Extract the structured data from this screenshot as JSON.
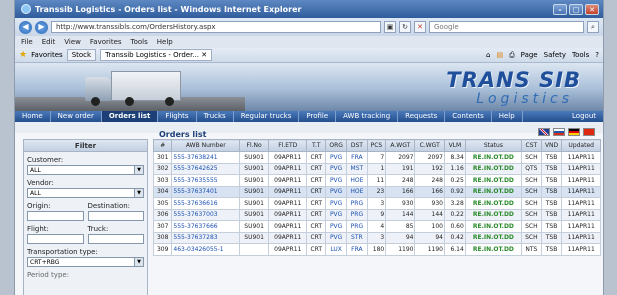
{
  "browser": {
    "title": "Transsib Logistics - Orders list - Windows Internet Explorer",
    "url": "http://www.transsibls.com/OrdersHistory.aspx",
    "search_placeholder": "Google",
    "menu": [
      "File",
      "Edit",
      "View",
      "Favorites",
      "Tools",
      "Help"
    ],
    "favorites_label": "Favorites",
    "tabs": [
      "Stock",
      "Transsib Logistics - Order..."
    ],
    "commands": [
      "Page",
      "Safety",
      "Tools"
    ]
  },
  "brand": {
    "line1": "TRANS SIB",
    "line2": "Logistics"
  },
  "nav": [
    "Home",
    "New order",
    "Orders list",
    "Flights",
    "Trucks",
    "Regular trucks",
    "Profile",
    "AWB tracking",
    "Requests",
    "Contents",
    "Help",
    "Logout"
  ],
  "nav_active": "Orders list",
  "page_title": "Orders list",
  "filter": {
    "title": "Filter",
    "customer_label": "Customer:",
    "customer_value": "ALL",
    "vendor_label": "Vendor:",
    "vendor_value": "ALL",
    "origin_label": "Origin:",
    "destination_label": "Destination:",
    "flight_label": "Flight:",
    "truck_label": "Truck:",
    "transport_label": "Transportation type:",
    "transport_value": "CRT+RBG",
    "period_label": "Period type:"
  },
  "table": {
    "columns": [
      "#",
      "AWB Number",
      "Fl.No",
      "Fl.ETD",
      "T.T",
      "ORG",
      "DST",
      "PCS",
      "A.WGT",
      "C.WGT",
      "VLM",
      "Status",
      "CST",
      "VND",
      "Updated"
    ],
    "rows": [
      [
        "301",
        "555-37638241",
        "SU901",
        "09APR11",
        "CRT",
        "PVG",
        "FRA",
        "7",
        "2097",
        "2097",
        "8.34",
        "RE.IN.OT.DD",
        "SCH",
        "TSB",
        "11APR11"
      ],
      [
        "302",
        "555-37642625",
        "SU901",
        "09APR11",
        "CRT",
        "PVG",
        "MST",
        "1",
        "191",
        "192",
        "1.16",
        "RE.IN.OT.DD",
        "QTS",
        "TSB",
        "11APR11"
      ],
      [
        "303",
        "555-37635555",
        "SU901",
        "09APR11",
        "CRT",
        "PVG",
        "HOE",
        "11",
        "248",
        "248",
        "0.25",
        "RE.IN.OT.DD",
        "SCH",
        "TSB",
        "11APR11"
      ],
      [
        "304",
        "555-37637401",
        "SU901",
        "09APR11",
        "CRT",
        "PVG",
        "HOE",
        "23",
        "166",
        "166",
        "0.92",
        "RE.IN.OT.DD",
        "SCH",
        "TSB",
        "11APR11"
      ],
      [
        "305",
        "555-37636616",
        "SU901",
        "09APR11",
        "CRT",
        "PVG",
        "PRG",
        "3",
        "930",
        "930",
        "3.28",
        "RE.IN.OT.DD",
        "SCH",
        "TSB",
        "11APR11"
      ],
      [
        "306",
        "555-37637003",
        "SU901",
        "09APR11",
        "CRT",
        "PVG",
        "PRG",
        "9",
        "144",
        "144",
        "0.22",
        "RE.IN.OT.DD",
        "SCH",
        "TSB",
        "11APR11"
      ],
      [
        "307",
        "555-37637666",
        "SU901",
        "09APR11",
        "CRT",
        "PVG",
        "PRG",
        "4",
        "85",
        "100",
        "0.60",
        "RE.IN.OT.DD",
        "SCH",
        "TSB",
        "11APR11"
      ],
      [
        "308",
        "555-37637283",
        "SU901",
        "09APR11",
        "CRT",
        "PVG",
        "STR",
        "3",
        "94",
        "94",
        "0.42",
        "RE.IN.OT.DD",
        "SCH",
        "TSB",
        "11APR11"
      ],
      [
        "309",
        "463-03426055-1",
        "",
        "09APR11",
        "CRT",
        "LUX",
        "FRA",
        "180",
        "1190",
        "1190",
        "6.14",
        "RE.IN.OT.DD",
        "NTS",
        "TSB",
        "11APR11"
      ]
    ]
  },
  "colors": {
    "accent": "#1f4e9a",
    "nav_bg": "#2f5c9c",
    "status_green": "#2a8a2a"
  }
}
